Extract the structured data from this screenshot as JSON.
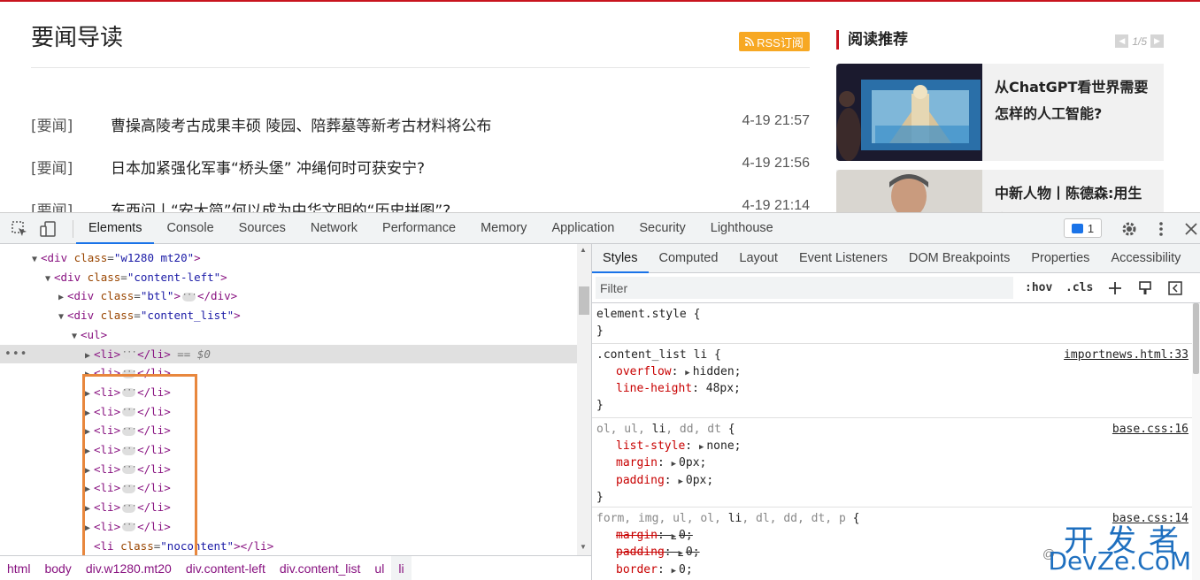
{
  "page": {
    "news_title": "要闻导读",
    "rss_label": "RSS订阅",
    "news_items": [
      {
        "tag": "[要闻]",
        "headline": "曹操高陵考古成果丰硕 陵园、陪葬墓等新考古材料将公布",
        "time": "4-19 21:57"
      },
      {
        "tag": "[要闻]",
        "headline": "日本加紧强化军事“桥头堡” 冲绳何时可获安宁?",
        "time": "4-19 21:56"
      },
      {
        "tag": "[要闻]",
        "headline": "东西问丨“安大简”何以成为中华文明的“历史拼图”?",
        "time": "4-19 21:14"
      }
    ],
    "side_title": "阅读推荐",
    "pager": "1/5",
    "cards": [
      {
        "text": "从ChatGPT看世界需要怎样的人工智能?"
      },
      {
        "text": "中新人物丨陈德森:用生命热爱电影 想拍作印"
      }
    ]
  },
  "devtools": {
    "tabs": [
      "Elements",
      "Console",
      "Sources",
      "Network",
      "Performance",
      "Memory",
      "Application",
      "Security",
      "Lighthouse"
    ],
    "active_tab": "Elements",
    "issues_count": "1",
    "dom": {
      "line0": {
        "tag_open": "<div ",
        "attr": "class",
        "eq": "=",
        "val": "\"w1280 mt20\"",
        "tag_close": ">"
      },
      "line1": {
        "tag_open": "<div ",
        "attr": "class",
        "eq": "=",
        "val": "\"content-left\"",
        "tag_close": ">"
      },
      "line2": {
        "tag_open": "<div ",
        "attr": "class",
        "eq": "=",
        "val": "\"btl\"",
        "tag_close": ">",
        "end": "</div>"
      },
      "line3": {
        "tag_open": "<div ",
        "attr": "class",
        "eq": "=",
        "val": "\"content_list\"",
        "tag_close": ">"
      },
      "line4": {
        "tag_open": "<ul>"
      },
      "li_open": "<li>",
      "li_close": "</li>",
      "selected_suffix": "== $0",
      "row_dots": "•••",
      "last": {
        "tag_open": "<li ",
        "attr": "class",
        "eq": "=",
        "val": "\"nocontent\"",
        "tag_close": "></li>"
      }
    },
    "breadcrumb": [
      "html",
      "body",
      "div.w1280.mt20",
      "div.content-left",
      "div.content_list",
      "ul",
      "li"
    ],
    "style_tabs": [
      "Styles",
      "Computed",
      "Layout",
      "Event Listeners",
      "DOM Breakpoints",
      "Properties",
      "Accessibility"
    ],
    "active_style_tab": "Styles",
    "filter_placeholder": "Filter",
    "hov": ":hov",
    "cls": ".cls",
    "rules": {
      "r0": {
        "selector": "element.style {",
        "close": "}"
      },
      "r1": {
        "selector": ".content_list li {",
        "source": "importnews.html:33",
        "close": "}",
        "d0": {
          "name": "overflow",
          "value": "hidden;"
        },
        "d1": {
          "name": "line-height",
          "value": "48px;"
        }
      },
      "r2": {
        "sel_dim1": "ol, ul, ",
        "sel_main": "li",
        "sel_dim2": ", dd, dt",
        "sel_end": " {",
        "source": "base.css:16",
        "close": "}",
        "d0": {
          "name": "list-style",
          "value": "none;"
        },
        "d1": {
          "name": "margin",
          "value": "0px;"
        },
        "d2": {
          "name": "padding",
          "value": "0px;"
        }
      },
      "r3": {
        "sel_dim1": "form, img, ul, ol, ",
        "sel_main": "li",
        "sel_dim2": ", dl, dd, dt, p",
        "sel_end": " {",
        "source": "base.css:14",
        "d0": {
          "name": "margin",
          "value": "0;"
        },
        "d1": {
          "name": "padding",
          "value": "0;"
        },
        "d2": {
          "name": "border",
          "value": "0;"
        }
      }
    }
  },
  "watermark": {
    "cn": "开发者",
    "en": "DevZe.CoM",
    "at": "@"
  }
}
